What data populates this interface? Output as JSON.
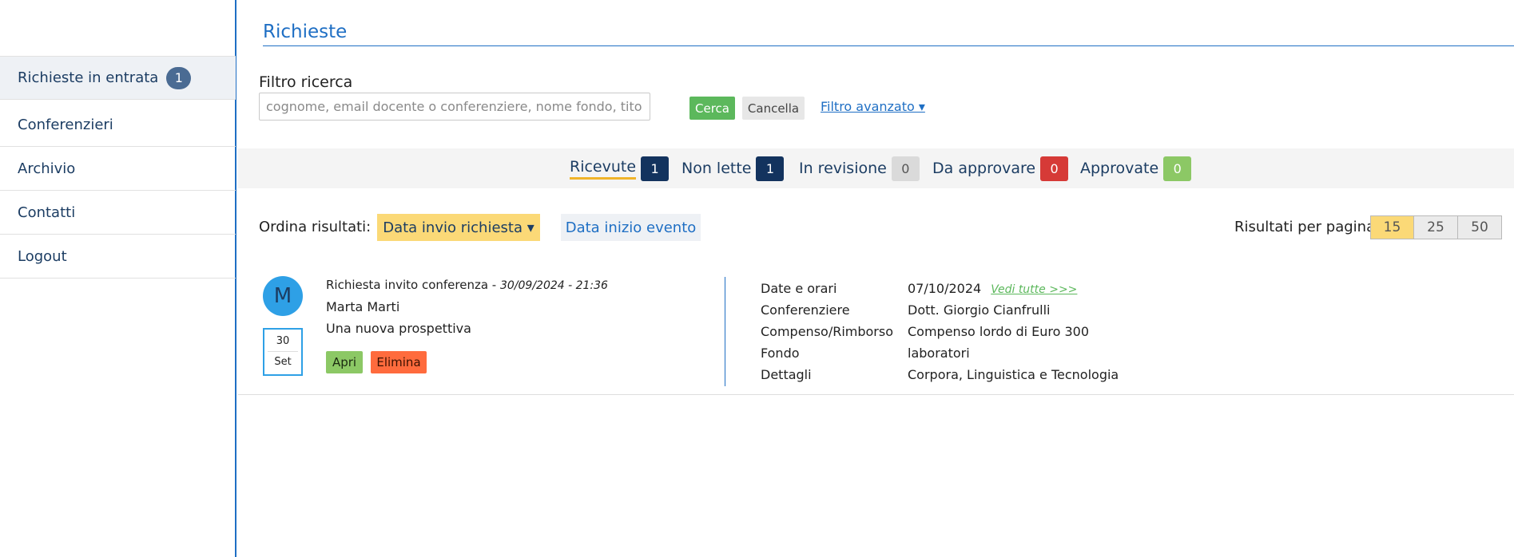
{
  "sidebar": {
    "items": [
      {
        "label": "Richieste in entrata",
        "badge": "1"
      },
      {
        "label": "Conferenzieri"
      },
      {
        "label": "Archivio"
      },
      {
        "label": "Contatti"
      },
      {
        "label": "Logout"
      }
    ]
  },
  "header": {
    "title": "Richieste"
  },
  "filter": {
    "label": "Filtro ricerca",
    "placeholder": "cognome, email docente o conferenziere, nome fondo, titolo",
    "value": "",
    "search_label": "Cerca",
    "clear_label": "Cancella",
    "advanced_label": "Filtro avanzato ▾"
  },
  "tabs": [
    {
      "label": "Ricevute",
      "count": "1",
      "color": "#13335e"
    },
    {
      "label": "Non lette",
      "count": "1",
      "color": "#13335e"
    },
    {
      "label": "In revisione",
      "count": "0",
      "color": "#dadada"
    },
    {
      "label": "Da approvare",
      "count": "0",
      "color": "#d63a37"
    },
    {
      "label": "Approvate",
      "count": "0",
      "color": "#8cc865"
    }
  ],
  "sort": {
    "label": "Ordina risultati:",
    "options": [
      "Data invio richiesta ▾",
      "Data inizio evento"
    ]
  },
  "per_page": {
    "label": "Risultati per pagina:",
    "options": [
      "15",
      "25",
      "50"
    ],
    "selected": "15"
  },
  "request": {
    "avatar_letter": "M",
    "day": "30",
    "month": "Set",
    "title": "Richiesta invito conferenza - ",
    "datetime": "30/09/2024 - 21:36",
    "name": "Marta Marti",
    "subtitle": "Una nuova prospettiva",
    "open_label": "Apri",
    "delete_label": "Elimina",
    "details": [
      {
        "key": "Date e orari",
        "value": "07/10/2024",
        "link": "Vedi tutte >>>"
      },
      {
        "key": "Conferenziere",
        "value": "Dott. Giorgio Cianfrulli"
      },
      {
        "key": "Compenso/Rimborso",
        "value": "Compenso lordo di Euro 300"
      },
      {
        "key": "Fondo",
        "value": "laboratori"
      },
      {
        "key": "Dettagli",
        "value": "Corpora, Linguistica e Tecnologia"
      }
    ]
  },
  "colors": {
    "accent": "#1f6fc4",
    "highlight": "#fbd977",
    "success": "#5cb85c",
    "danger": "#ff6b3d"
  }
}
